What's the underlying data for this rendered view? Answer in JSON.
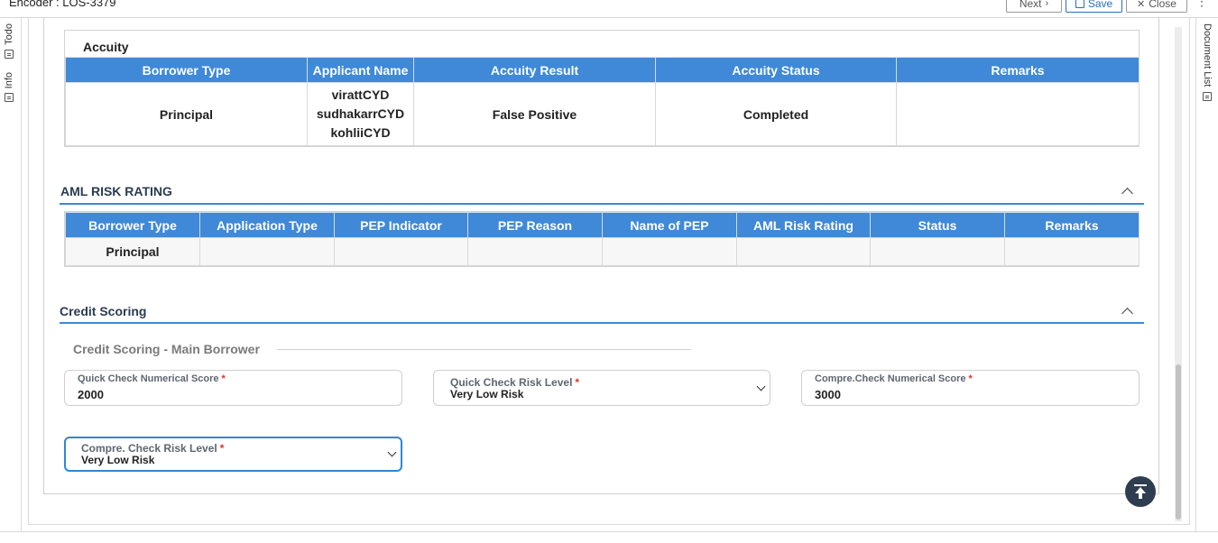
{
  "header": {
    "title": "Encoder : LOS-3379",
    "next_label": "Next",
    "save_label": "Save",
    "close_label": "Close"
  },
  "left_rail": {
    "todo_label": "Todo",
    "info_label": "Info"
  },
  "right_rail": {
    "document_list_label": "Document List"
  },
  "accuity": {
    "title": "Accuity",
    "columns": [
      "Borrower Type",
      "Applicant Name",
      "Accuity Result",
      "Accuity Status",
      "Remarks"
    ],
    "row": {
      "borrower_type": "Principal",
      "applicant_names": [
        "virattCYD",
        "sudhakarrCYD",
        "kohliiCYD"
      ],
      "result": "False Positive",
      "status": "Completed",
      "remarks": ""
    }
  },
  "aml": {
    "title": "AML RISK RATING",
    "columns": [
      "Borrower Type",
      "Application Type",
      "PEP Indicator",
      "PEP Reason",
      "Name of PEP",
      "AML Risk Rating",
      "Status",
      "Remarks"
    ],
    "row": {
      "borrower_type": "Principal",
      "application_type": "",
      "pep_indicator": "",
      "pep_reason": "",
      "name_of_pep": "",
      "aml_risk_rating": "",
      "status": "",
      "remarks": ""
    }
  },
  "credit_scoring": {
    "title": "Credit Scoring",
    "subheading": "Credit Scoring - Main Borrower",
    "quick_numerical": {
      "label": "Quick Check Numerical Score",
      "value": "2000"
    },
    "quick_risk": {
      "label": "Quick Check Risk Level",
      "value": "Very Low Risk"
    },
    "compre_numerical": {
      "label": "Compre.Check Numerical Score",
      "value": "3000"
    },
    "compre_risk": {
      "label": "Compre. Check Risk Level",
      "value": "Very Low Risk"
    },
    "required_marker": "*"
  },
  "colors": {
    "accent": "#3f89d8",
    "fab": "#2e3d4f",
    "required": "#e0322b"
  },
  "icons": [
    "chevron-right-icon",
    "save-icon",
    "close-icon",
    "kebab-menu-icon",
    "todo-icon",
    "info-icon",
    "document-list-icon",
    "chevron-up-icon",
    "chevron-down-icon",
    "scroll-to-top-icon"
  ]
}
